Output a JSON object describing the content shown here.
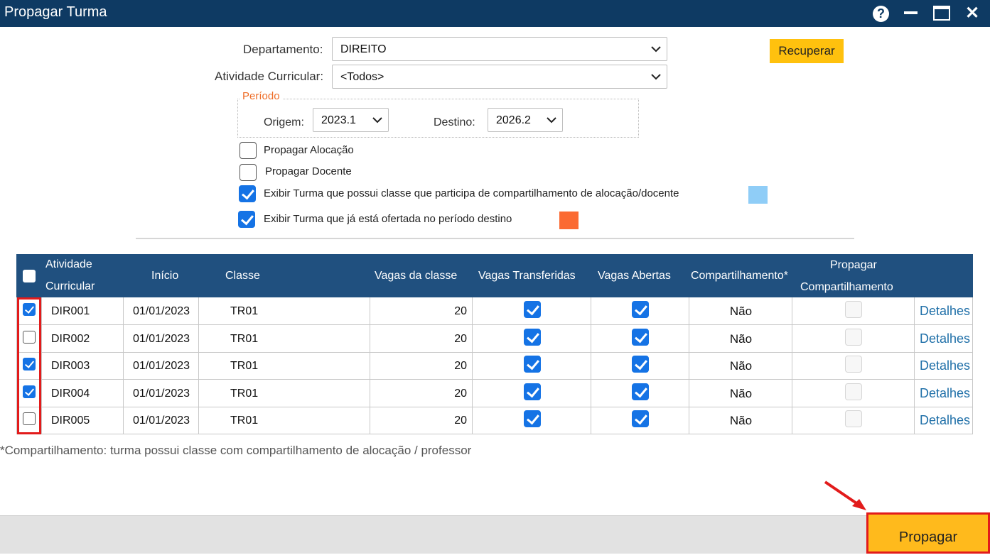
{
  "window": {
    "title": "Propagar Turma",
    "help_glyph": "?",
    "close_glyph": "✕"
  },
  "form": {
    "departamento_label": "Departamento:",
    "departamento_value": "DIREITO",
    "atividade_label": "Atividade Curricular:",
    "atividade_value": "<Todos>",
    "recuperar_label": "Recuperar",
    "periodo_legend": "Período",
    "origem_label": "Origem:",
    "origem_value": "2023.1",
    "destino_label": "Destino:",
    "destino_value": "2026.2",
    "options": [
      {
        "label": "Propagar Alocação",
        "checked": false
      },
      {
        "label": "Propagar Docente",
        "checked": false
      },
      {
        "label": "Exibir Turma que possui classe que participa de compartilhamento de alocação/docente",
        "checked": true,
        "swatch_color": "#8fcdf7"
      },
      {
        "label": "Exibir Turma que já está ofertada no período destino",
        "checked": true,
        "swatch_color": "#fb6a32"
      }
    ]
  },
  "table": {
    "headers": {
      "atividade_line1": "Atividade",
      "atividade_line2": "Curricular",
      "inicio": "Início",
      "classe": "Classe",
      "vagas_classe": "Vagas da classe",
      "vagas_transferidas": "Vagas Transferidas",
      "vagas_abertas": "Vagas Abertas",
      "compartilhamento": "Compartilhamento*",
      "propagar_line1": "Propagar",
      "propagar_line2": "Compartilhamento"
    },
    "rows": [
      {
        "selected": true,
        "atividade": "DIR001",
        "inicio": "01/01/2023",
        "classe": "TR01",
        "vagas": "20",
        "transferidas": true,
        "abertas": true,
        "compartilhamento": "Não",
        "propagar": false,
        "detalhes": "Detalhes"
      },
      {
        "selected": false,
        "atividade": "DIR002",
        "inicio": "01/01/2023",
        "classe": "TR01",
        "vagas": "20",
        "transferidas": true,
        "abertas": true,
        "compartilhamento": "Não",
        "propagar": false,
        "detalhes": "Detalhes"
      },
      {
        "selected": true,
        "atividade": "DIR003",
        "inicio": "01/01/2023",
        "classe": "TR01",
        "vagas": "20",
        "transferidas": true,
        "abertas": true,
        "compartilhamento": "Não",
        "propagar": false,
        "detalhes": "Detalhes"
      },
      {
        "selected": true,
        "atividade": "DIR004",
        "inicio": "01/01/2023",
        "classe": "TR01",
        "vagas": "20",
        "transferidas": true,
        "abertas": true,
        "compartilhamento": "Não",
        "propagar": false,
        "detalhes": "Detalhes"
      },
      {
        "selected": false,
        "atividade": "DIR005",
        "inicio": "01/01/2023",
        "classe": "TR01",
        "vagas": "20",
        "transferidas": true,
        "abertas": true,
        "compartilhamento": "Não",
        "propagar": false,
        "detalhes": "Detalhes"
      }
    ]
  },
  "footnote": "*Compartilhamento: turma possui classe com compartilhamento de alocação / professor",
  "footer": {
    "propagar_label": "Propagar"
  },
  "colors": {
    "titlebar": "#0e3a63",
    "table_header": "#20507f",
    "accent_button": "#ffba1c",
    "annotation": "#e21b1b",
    "checkbox": "#1573e5"
  }
}
